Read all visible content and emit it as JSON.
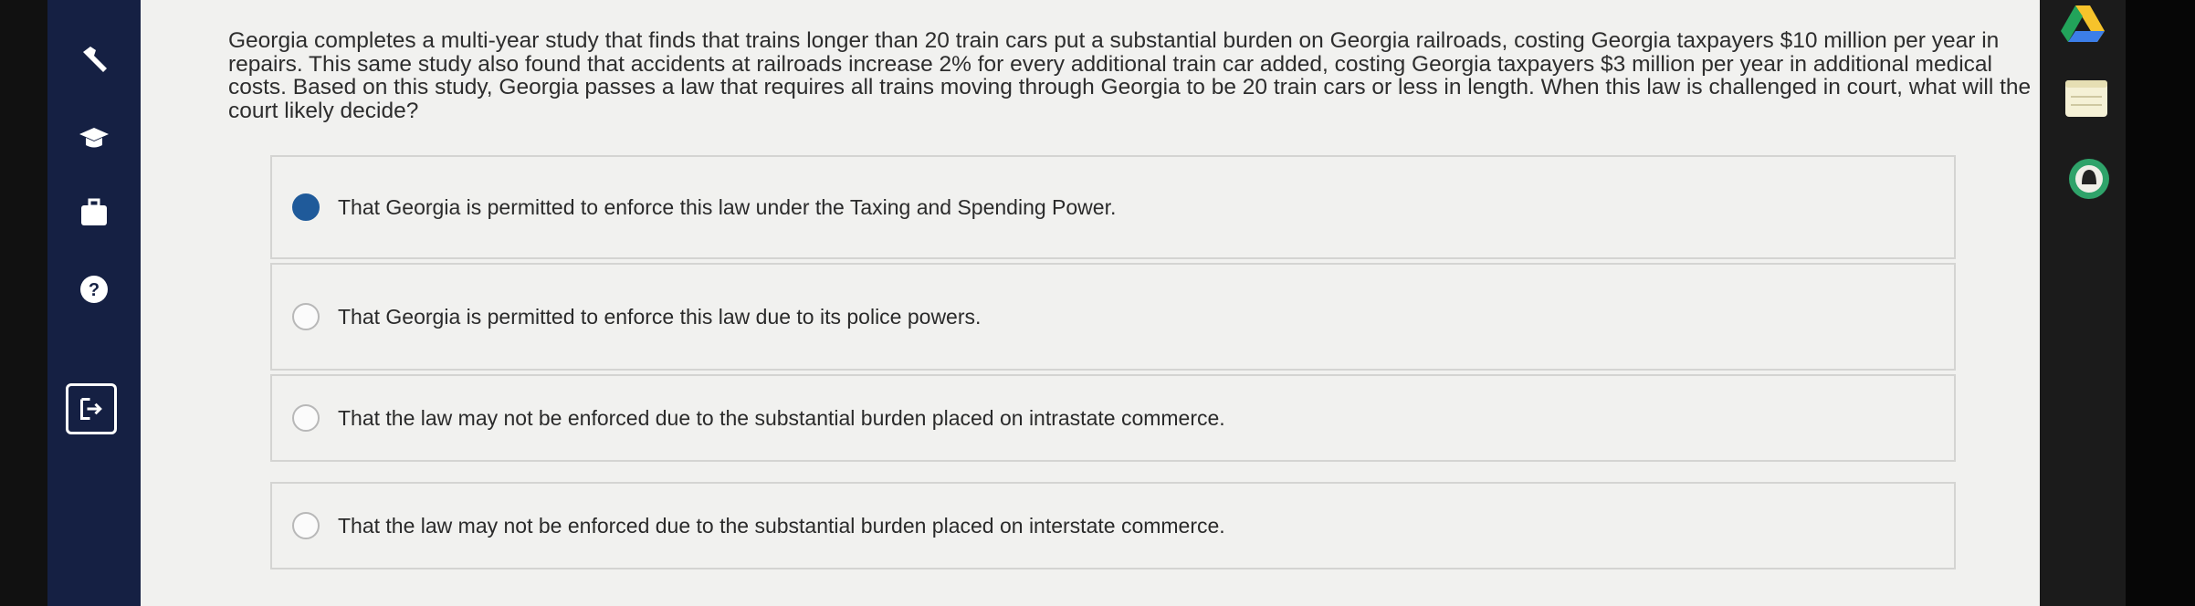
{
  "question": {
    "text": "Georgia completes a multi-year study that finds that trains longer than 20 train cars put a substantial burden on Georgia railroads, costing Georgia taxpayers $10 million per year in repairs. This same study also found that accidents at railroads increase 2% for every additional train car added, costing Georgia taxpayers $3 million per year in additional medical costs. Based on this study, Georgia passes a law that requires all trains moving through Georgia to be 20 train cars or less in length. When this law is challenged in court, what will the court likely decide?"
  },
  "options": [
    {
      "label": "That Georgia is permitted to enforce this law under the Taxing and Spending Power.",
      "selected": true
    },
    {
      "label": "That Georgia is permitted to enforce this law due to its police powers.",
      "selected": false
    },
    {
      "label": "That the law may not be enforced due to the substantial burden placed on intrastate commerce.",
      "selected": false
    },
    {
      "label": "That the law may not be enforced due to the substantial burden placed on interstate commerce.",
      "selected": false
    }
  ],
  "sidebar": {
    "icons": [
      "wrench-icon",
      "graduation-cap-icon",
      "briefcase-icon",
      "help-icon",
      "exit-icon"
    ],
    "help_glyph": "?"
  },
  "rightbar": {
    "icons": [
      "google-drive-icon",
      "notes-icon",
      "circle-app-icon"
    ]
  },
  "colors": {
    "sidebar_bg": "#152043",
    "selected_radio": "#1f5a9a",
    "content_bg": "#f1f1ef"
  }
}
